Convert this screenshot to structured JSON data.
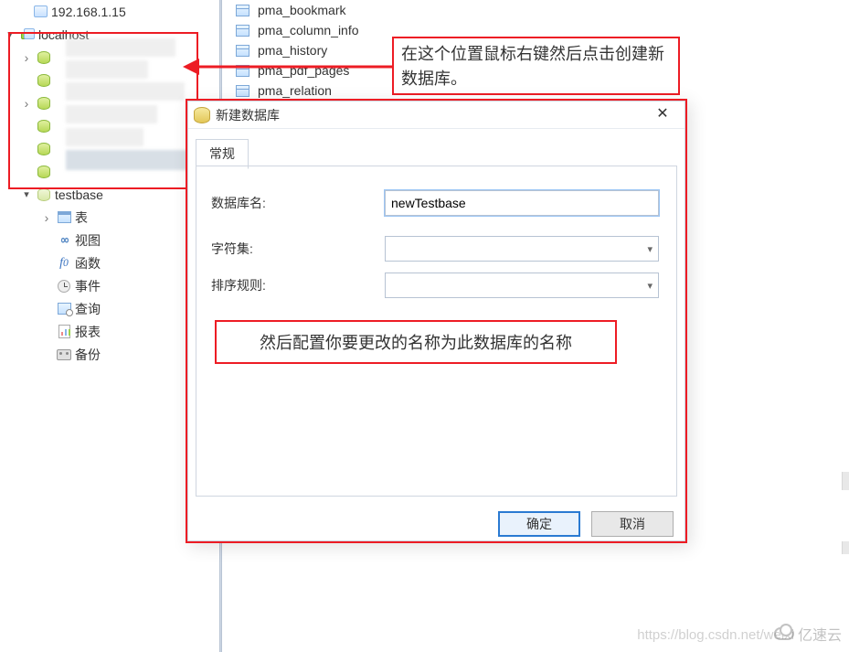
{
  "tree": {
    "server_ip": "192.168.1.15",
    "connection": "localhost",
    "databases": [
      "",
      "",
      "",
      "",
      "",
      "",
      "testbase"
    ],
    "testbase_children": {
      "tables": "表",
      "views": "视图",
      "functions": "函数",
      "events": "事件",
      "queries": "查询",
      "reports": "报表",
      "backup": "备份"
    }
  },
  "right_tables": [
    "pma_bookmark",
    "pma_column_info",
    "pma_history",
    "pma_pdf_pages",
    "pma_relation"
  ],
  "callout1_text": "在这个位置鼠标右键然后点击创建新数据库。",
  "callout2_text": "然后配置你要更改的名称为此数据库的名称",
  "dialog": {
    "title": "新建数据库",
    "tab_general": "常规",
    "label_dbname": "数据库名:",
    "label_charset": "字符集:",
    "label_collation": "排序规则:",
    "value_dbname": "newTestbase",
    "btn_ok": "确定",
    "btn_cancel": "取消"
  },
  "watermark": {
    "url": "https://blog.csdn.net/weixi",
    "logo_text": "亿速云"
  }
}
